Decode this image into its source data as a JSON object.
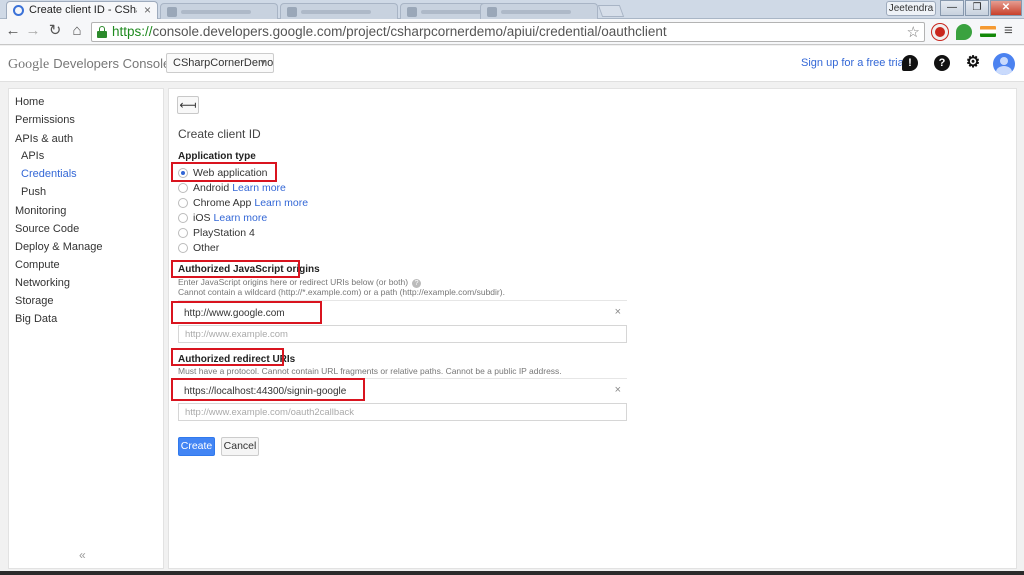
{
  "browser": {
    "active_tab_title": "Create client ID - CSharpC",
    "url_scheme": "https://",
    "url_rest": "console.developers.google.com/project/csharpcornerdemo/apiui/credential/oauthclient",
    "user_label": "Jeetendra",
    "icons": {
      "back": "back-arrow-icon",
      "forward": "forward-arrow-icon",
      "reload": "reload-icon",
      "home": "home-icon",
      "lock": "lock-icon",
      "star": "star-icon",
      "menu": "hamburger-menu-icon"
    }
  },
  "header": {
    "brand_google": "Google",
    "brand_product": "Developers Console",
    "project": "CSharpCornerDemo",
    "signup": "Sign up for a free trial."
  },
  "sidebar": {
    "items": [
      {
        "label": "Home",
        "sub": false,
        "active": false
      },
      {
        "label": "Permissions",
        "sub": false,
        "active": false
      },
      {
        "label": "APIs & auth",
        "sub": false,
        "active": false
      },
      {
        "label": "APIs",
        "sub": true,
        "active": false
      },
      {
        "label": "Credentials",
        "sub": true,
        "active": true
      },
      {
        "label": "Push",
        "sub": true,
        "active": false
      },
      {
        "label": "Monitoring",
        "sub": false,
        "active": false
      },
      {
        "label": "Source Code",
        "sub": false,
        "active": false
      },
      {
        "label": "Deploy & Manage",
        "sub": false,
        "active": false
      },
      {
        "label": "Compute",
        "sub": false,
        "active": false
      },
      {
        "label": "Networking",
        "sub": false,
        "active": false
      },
      {
        "label": "Storage",
        "sub": false,
        "active": false
      },
      {
        "label": "Big Data",
        "sub": false,
        "active": false
      }
    ],
    "collapse": "«"
  },
  "main": {
    "back": "⟻",
    "title": "Create client ID",
    "app_type_label": "Application type",
    "app_types": [
      {
        "label": "Web application",
        "checked": true,
        "learn_more": ""
      },
      {
        "label": "Android",
        "checked": false,
        "learn_more": "Learn more"
      },
      {
        "label": "Chrome App",
        "checked": false,
        "learn_more": "Learn more"
      },
      {
        "label": "iOS",
        "checked": false,
        "learn_more": "Learn more"
      },
      {
        "label": "PlayStation 4",
        "checked": false,
        "learn_more": ""
      },
      {
        "label": "Other",
        "checked": false,
        "learn_more": ""
      }
    ],
    "js_origins_label": "Authorized JavaScript origins",
    "js_origins_hint1": "Enter JavaScript origins here or redirect URIs below (or both)",
    "js_origins_hint2": "Cannot contain a wildcard (http://*.example.com) or a path (http://example.com/subdir).",
    "js_origin_value": "http://www.google.com",
    "js_origin_placeholder": "http://www.example.com",
    "redirect_label": "Authorized redirect URIs",
    "redirect_hint": "Must have a protocol. Cannot contain URL fragments or relative paths. Cannot be a public IP address.",
    "redirect_value": "https://localhost:44300/signin-google",
    "redirect_placeholder": "http://www.example.com/oauth2callback",
    "remove": "×",
    "create": "Create",
    "cancel": "Cancel"
  },
  "colors": {
    "accent": "#3367d6",
    "primary_button": "#4285f4",
    "annotation": "#d9141f"
  }
}
